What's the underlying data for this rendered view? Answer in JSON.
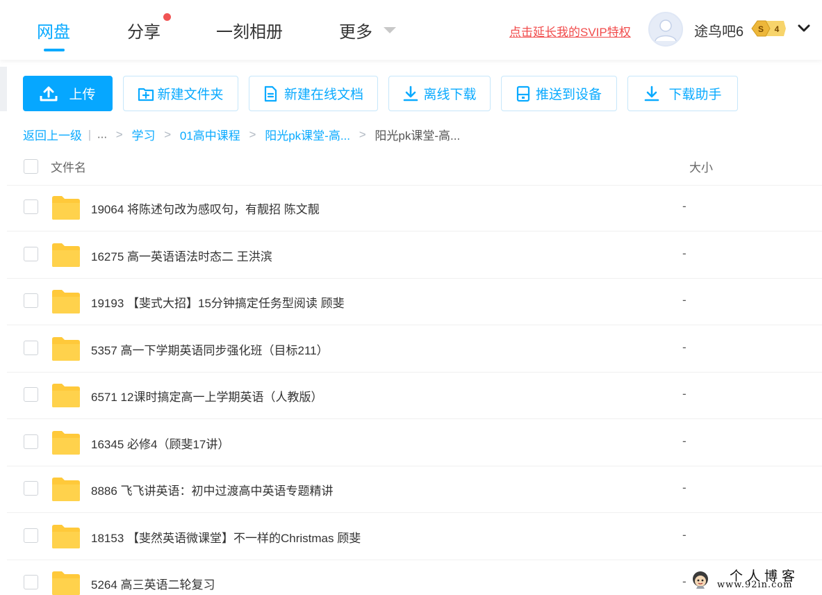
{
  "nav": {
    "items": [
      "网盘",
      "分享",
      "一刻相册",
      "更多"
    ],
    "active": "网盘",
    "svip_link": "点击延长我的SVIP特权",
    "username": "途鸟吧6",
    "vip_level": "4",
    "vip_symbol": "S"
  },
  "toolbar": {
    "upload": "上传",
    "new_folder": "新建文件夹",
    "new_doc": "新建在线文档",
    "offline_download": "离线下载",
    "push_device": "推送到设备",
    "download_helper": "下载助手"
  },
  "breadcrumb": {
    "back": "返回上一级",
    "divider": "|",
    "ellipsis": "...",
    "sep": ">",
    "items": [
      "学习",
      "01高中课程",
      "阳光pk课堂-高..."
    ],
    "current": "阳光pk课堂-高..."
  },
  "list": {
    "header_name": "文件名",
    "header_size": "大小",
    "rows": [
      {
        "name": "19064 将陈述句改为感叹句，有靓招 陈文靓",
        "size": "-"
      },
      {
        "name": "16275 高一英语语法时态二 王洪滨",
        "size": "-"
      },
      {
        "name": "19193 【斐式大招】15分钟搞定任务型阅读 顾斐",
        "size": "-"
      },
      {
        "name": "5357 高一下学期英语同步强化班（目标211）",
        "size": "-"
      },
      {
        "name": "6571 12课时搞定高一上学期英语（人教版）",
        "size": "-"
      },
      {
        "name": "16345 必修4（顾斐17讲）",
        "size": "-"
      },
      {
        "name": "8886 飞飞讲英语：初中过渡高中英语专题精讲",
        "size": "-"
      },
      {
        "name": "18153 【斐然英语微课堂】不一样的Christmas 顾斐",
        "size": "-"
      },
      {
        "name": "5264 高三英语二轮复习",
        "size": "-"
      }
    ]
  },
  "watermark": {
    "title": "个人博客",
    "url": "www.92in.com"
  },
  "colors": {
    "accent": "#09AAFF",
    "svip_red": "#F14B4B",
    "folder_yellow": "#FFD24C",
    "notify_dot": "#F05454"
  },
  "icons": {
    "upload": "upload-icon",
    "new_folder": "folder-plus-icon",
    "new_doc": "document-icon",
    "offline_download": "download-icon",
    "push_device": "device-icon",
    "download_helper": "download-icon",
    "folder": "folder-icon",
    "user": "avatar-icon",
    "user_menu": "chevron-down-icon"
  }
}
